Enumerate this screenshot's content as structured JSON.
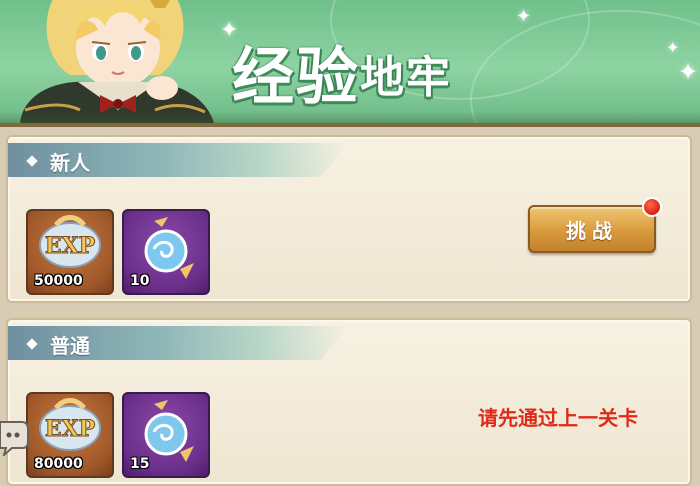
{
  "header": {
    "title_big": "经验",
    "title_small": "地牢"
  },
  "dungeons": [
    {
      "name": "新人",
      "rewards": [
        {
          "icon": "exp-icon",
          "label": "EXP",
          "quantity": "50000"
        },
        {
          "icon": "blue-orb-icon",
          "quantity": "10"
        }
      ],
      "action": {
        "label": "挑战",
        "has_notification": true
      }
    },
    {
      "name": "普通",
      "rewards": [
        {
          "icon": "exp-icon",
          "label": "EXP",
          "quantity": "80000"
        },
        {
          "icon": "blue-orb-icon",
          "quantity": "15"
        }
      ],
      "locked_message": "请先通过上一关卡"
    }
  ],
  "colors": {
    "header_green": "#8ed3a2",
    "panel_bg": "#f7f1e2",
    "button_gold": "#d99a3e",
    "locked_red": "#e02a18"
  }
}
